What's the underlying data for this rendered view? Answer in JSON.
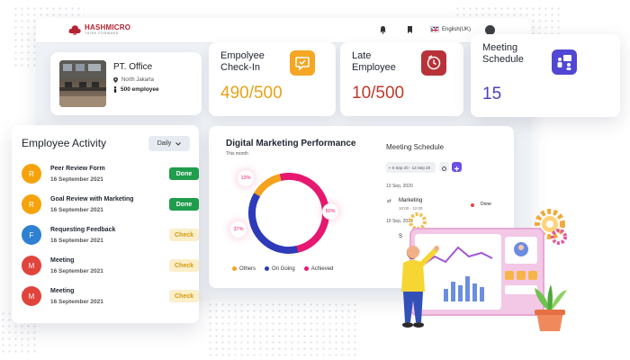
{
  "brand": {
    "name": "HASHMICRO",
    "tagline": "THINK FORWARD"
  },
  "topbar": {
    "language": "English(UK)"
  },
  "office": {
    "title": "PT. Office",
    "location": "North Jakarta",
    "employees": "500 employee"
  },
  "stats": [
    {
      "title_line1": "Empolyee",
      "title_line2": "Check-In",
      "value": "490/500",
      "icon": "chat-check-icon",
      "color": "#e8a21a"
    },
    {
      "title_line1": "Late",
      "title_line2": "Employee",
      "value": "10/500",
      "icon": "clock-alert-icon",
      "color": "#c0392b"
    },
    {
      "title_line1": "Meeting",
      "title_line2": "Schedule",
      "value": "15",
      "icon": "people-board-icon",
      "color": "#5b4fd6"
    }
  ],
  "marketing": {
    "title": "Digital Marketing Performance",
    "subtitle": "This month",
    "legend": [
      "Others",
      "On Going",
      "Achieved"
    ]
  },
  "chart_data": {
    "type": "pie",
    "title": "Digital Marketing Performance",
    "categories": [
      "Others",
      "On Going",
      "Achieved"
    ],
    "values": [
      13,
      37,
      50
    ],
    "value_labels": [
      "13%",
      "37%",
      "50%"
    ],
    "colors": [
      "#f5a21e",
      "#2e3bb8",
      "#e6186f"
    ]
  },
  "meeting_schedule": {
    "title": "Meeting Schedule",
    "date_range": "6 Sep 20 - 13 Sep 20",
    "day1": "13 Sep, 2020",
    "item": "Marketing",
    "item_time": "10:00 - 12:00",
    "status": "Done",
    "day2": "10 Sep, 2020",
    "item2": "S"
  },
  "activity": {
    "title": "Employee Activity",
    "filter": "Daily",
    "rows": [
      {
        "initial": "R",
        "title": "Peer Review Form",
        "date": "16 September 2021",
        "status": "Done",
        "color": "#f5a30c"
      },
      {
        "initial": "R",
        "title": "Goal Review with Marketing",
        "date": "16 September 2021",
        "status": "Done",
        "color": "#f5a30c"
      },
      {
        "initial": "F",
        "title": "Requesting Feedback",
        "date": "16 September 2021",
        "status": "Check",
        "color": "#2f80d1"
      },
      {
        "initial": "M",
        "title": "Meeting",
        "date": "16 September 2021",
        "status": "Check",
        "color": "#e0443b"
      },
      {
        "initial": "M",
        "title": "Meeting",
        "date": "16 September 2021",
        "status": "Check",
        "color": "#e0443b"
      }
    ]
  }
}
